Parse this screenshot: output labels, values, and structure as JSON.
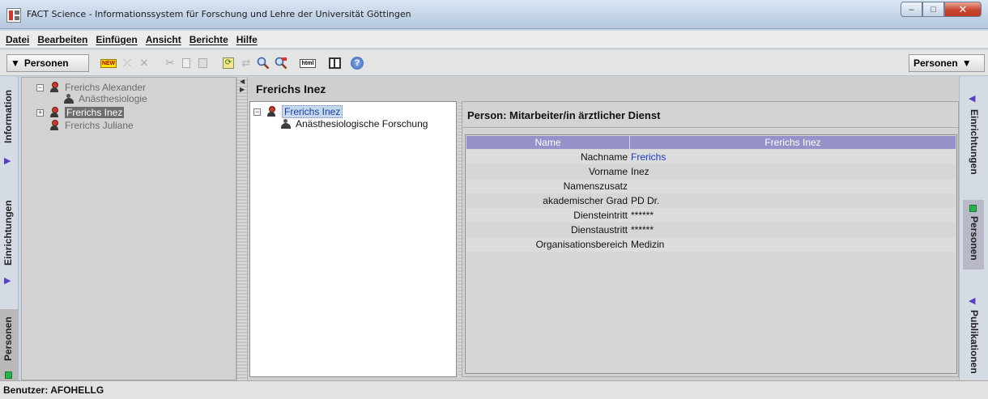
{
  "window": {
    "title": "FACT Science - Informationssystem für Forschung und Lehre der Universität Göttingen",
    "controls": {
      "minimize": "–",
      "maximize": "□",
      "close": "✕"
    }
  },
  "menu": [
    "Datei",
    "Bearbeiten",
    "Einfügen",
    "Ansicht",
    "Berichte",
    "Hilfe"
  ],
  "toolbar": {
    "left_dropdown": "Personen",
    "right_dropdown": "Personen",
    "new_badge": "NEW",
    "html_label": "html",
    "icons": [
      "new-icon",
      "link-icon",
      "delete-icon",
      "cut-icon",
      "copy-icon",
      "paste-icon",
      "refresh-icon",
      "transfer-icon",
      "search-icon",
      "search-replace-icon",
      "html-icon",
      "layout-icon",
      "help-icon"
    ]
  },
  "left_tabs": [
    "Information",
    "Einrichtungen",
    "Personen"
  ],
  "right_tabs": [
    "Einrichtungen",
    "Personen",
    "Publikationen"
  ],
  "tree": {
    "nodes": [
      {
        "label": "Frerichs Alexander",
        "children": [
          "Anästhesiologie"
        ]
      },
      {
        "label": "Frerichs Inez",
        "selected": true
      },
      {
        "label": "Frerichs Juliane"
      }
    ]
  },
  "main": {
    "title": "Frerichs Inez",
    "subtree": {
      "root": "Frerichs Inez",
      "child": "Anästhesiologische Forschung"
    },
    "detail": {
      "title": "Person: Mitarbeiter/in ärztlicher Dienst",
      "columns": [
        "Name",
        "Frerichs Inez"
      ],
      "rows": [
        {
          "name": "Nachname",
          "value": "Frerichs"
        },
        {
          "name": "Vorname",
          "value": "Inez"
        },
        {
          "name": "Namenszusatz",
          "value": ""
        },
        {
          "name": "akademischer Grad",
          "value": "PD Dr."
        },
        {
          "name": "Diensteintritt",
          "value": "******"
        },
        {
          "name": "Dienstaustritt",
          "value": "******"
        },
        {
          "name": "Organisationsbereich",
          "value": "Medizin"
        }
      ]
    }
  },
  "status": {
    "text": "Benutzer: AFOHELLG"
  }
}
